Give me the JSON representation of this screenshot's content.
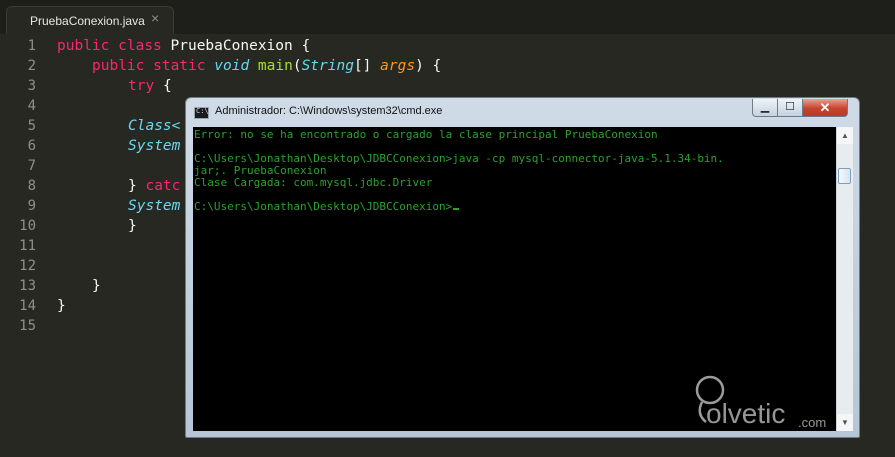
{
  "editor": {
    "tab": {
      "title": "PruebaConexion.java",
      "close_glyph": "×"
    },
    "line_numbers": [
      "1",
      "2",
      "3",
      "4",
      "5",
      "6",
      "7",
      "8",
      "9",
      "10",
      "11",
      "12",
      "13",
      "14",
      "15"
    ],
    "code": {
      "l1": {
        "kw1": "public",
        "kw2": "class",
        "name": "PruebaConexion",
        "brace": "{"
      },
      "l2": {
        "kw1": "public",
        "kw2": "static",
        "ret": "void",
        "fn": "main",
        "p1": "(",
        "type": "String",
        "p2": "[] ",
        "arg": "args",
        "p3": ") {"
      },
      "l3": {
        "kw": "try",
        "brace": "{"
      },
      "l5": {
        "type": "Class<"
      },
      "l6": {
        "text": "System"
      },
      "l8": {
        "brace": "}",
        "kw": "catc"
      },
      "l9": {
        "text": "System"
      },
      "l10": {
        "brace": "}"
      },
      "l13": {
        "brace": "}"
      },
      "l14": {
        "brace": "}"
      }
    }
  },
  "cmd": {
    "title": "Administrador: C:\\Windows\\system32\\cmd.exe",
    "icon": "C:\\",
    "buttons": {
      "minimize": "▁",
      "maximize": "☐",
      "close": "✕"
    },
    "lines": [
      "Error: no se ha encontrado o cargado la clase principal PruebaConexion",
      "",
      "C:\\Users\\Jonathan\\Desktop\\JDBCConexion>java -cp mysql-connector-java-5.1.34-bin.",
      "jar;. PruebaConexion",
      "Clase Cargada: com.mysql.jdbc.Driver",
      "",
      "C:\\Users\\Jonathan\\Desktop\\JDBCConexion>"
    ],
    "scroll": {
      "up": "▲",
      "down": "▼"
    }
  },
  "watermark": {
    "brand": "olvetic",
    "suffix": ".com"
  },
  "colors": {
    "editor_bg": "#272822",
    "keyword": "#f92672",
    "type": "#66d9ef",
    "function": "#a6e22e",
    "param": "#fd971f",
    "console_text": "#2ea02e"
  }
}
